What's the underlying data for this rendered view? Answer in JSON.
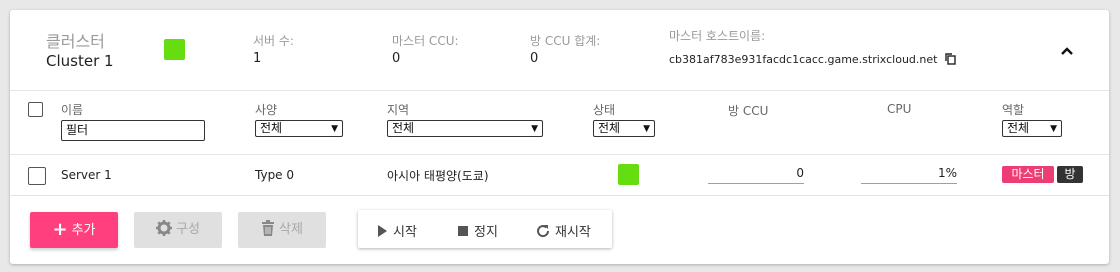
{
  "cluster": {
    "label": "클러스터",
    "name": "Cluster 1",
    "server_count_label": "서버 수:",
    "server_count": "1",
    "master_ccu_label": "마스터 CCU:",
    "master_ccu": "0",
    "room_ccu_total_label": "방 CCU 합계:",
    "room_ccu_total": "0",
    "master_host_label": "마스터 호스트이름:",
    "master_host": "cb381af783e931facdc1cacc.game.strixcloud.net",
    "copy_icon": "copy-icon",
    "collapse_icon": "chevron-up-icon",
    "status_color": "#66dd11"
  },
  "table": {
    "headers": {
      "name": "이름",
      "spec": "사양",
      "region": "지역",
      "status": "상태",
      "room_ccu": "방 CCU",
      "cpu": "CPU",
      "role": "역할"
    },
    "filters": {
      "name_placeholder": "필터",
      "spec": "전체",
      "region": "전체",
      "status": "전체",
      "role": "전체"
    },
    "rows": [
      {
        "name": "Server 1",
        "spec": "Type 0",
        "region": "아시아 태평양(도쿄)",
        "status_color": "#66dd11",
        "room_ccu": "0",
        "cpu": "1%",
        "roles": [
          "마스터",
          "방"
        ]
      }
    ]
  },
  "toolbar": {
    "add": "추가",
    "configure": "구성",
    "delete": "삭제",
    "start": "시작",
    "stop": "정지",
    "restart": "재시작",
    "accent": "#ff3f7e"
  }
}
